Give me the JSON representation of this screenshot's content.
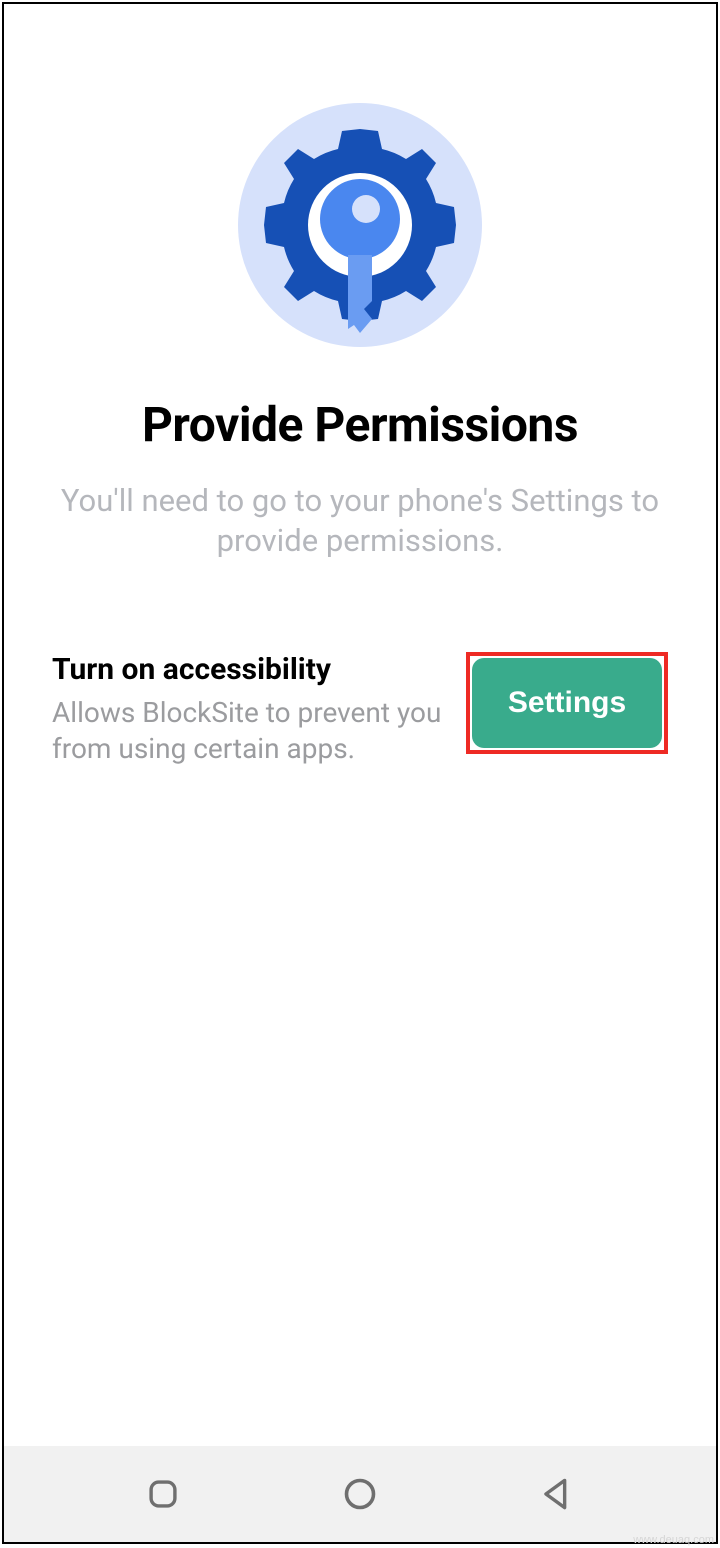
{
  "hero": {
    "icon": "gear-key-icon"
  },
  "title": "Provide Permissions",
  "subtitle": "You'll need to go to your phone's Settings to provide permissions.",
  "permission": {
    "title": "Turn on accessibility",
    "description": "Allows BlockSite to prevent you from using certain apps.",
    "button_label": "Settings"
  },
  "colors": {
    "accent_button": "#39ab8c",
    "highlight_border": "#ee2a24",
    "icon_bg": "#d6e1fb",
    "gear_fill": "#1650b5",
    "key_fill": "#4a87ef"
  },
  "watermark": "www.deuaq.com"
}
